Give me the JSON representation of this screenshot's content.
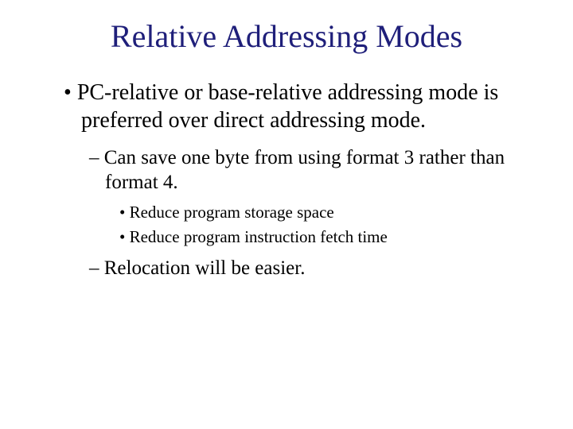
{
  "title": "Relative Addressing Modes",
  "bullets": {
    "l1_0": "PC-relative or base-relative addressing mode is preferred over direct addressing mode.",
    "l2_0": "Can save one byte from using format 3 rather than format 4.",
    "l3_0": "Reduce program storage space",
    "l3_1": "Reduce program instruction fetch time",
    "l2_1": "Relocation will be easier."
  }
}
